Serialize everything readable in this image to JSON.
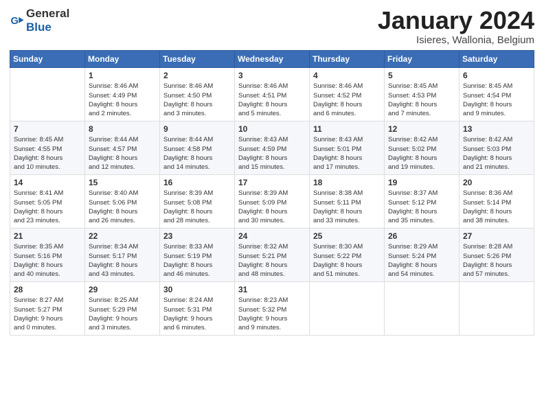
{
  "logo": {
    "text_general": "General",
    "text_blue": "Blue",
    "icon": "▶"
  },
  "header": {
    "month": "January 2024",
    "location": "Isieres, Wallonia, Belgium"
  },
  "weekdays": [
    "Sunday",
    "Monday",
    "Tuesday",
    "Wednesday",
    "Thursday",
    "Friday",
    "Saturday"
  ],
  "weeks": [
    [
      {
        "day": "",
        "info": ""
      },
      {
        "day": "1",
        "info": "Sunrise: 8:46 AM\nSunset: 4:49 PM\nDaylight: 8 hours\nand 2 minutes."
      },
      {
        "day": "2",
        "info": "Sunrise: 8:46 AM\nSunset: 4:50 PM\nDaylight: 8 hours\nand 3 minutes."
      },
      {
        "day": "3",
        "info": "Sunrise: 8:46 AM\nSunset: 4:51 PM\nDaylight: 8 hours\nand 5 minutes."
      },
      {
        "day": "4",
        "info": "Sunrise: 8:46 AM\nSunset: 4:52 PM\nDaylight: 8 hours\nand 6 minutes."
      },
      {
        "day": "5",
        "info": "Sunrise: 8:45 AM\nSunset: 4:53 PM\nDaylight: 8 hours\nand 7 minutes."
      },
      {
        "day": "6",
        "info": "Sunrise: 8:45 AM\nSunset: 4:54 PM\nDaylight: 8 hours\nand 9 minutes."
      }
    ],
    [
      {
        "day": "7",
        "info": "Sunrise: 8:45 AM\nSunset: 4:55 PM\nDaylight: 8 hours\nand 10 minutes."
      },
      {
        "day": "8",
        "info": "Sunrise: 8:44 AM\nSunset: 4:57 PM\nDaylight: 8 hours\nand 12 minutes."
      },
      {
        "day": "9",
        "info": "Sunrise: 8:44 AM\nSunset: 4:58 PM\nDaylight: 8 hours\nand 14 minutes."
      },
      {
        "day": "10",
        "info": "Sunrise: 8:43 AM\nSunset: 4:59 PM\nDaylight: 8 hours\nand 15 minutes."
      },
      {
        "day": "11",
        "info": "Sunrise: 8:43 AM\nSunset: 5:01 PM\nDaylight: 8 hours\nand 17 minutes."
      },
      {
        "day": "12",
        "info": "Sunrise: 8:42 AM\nSunset: 5:02 PM\nDaylight: 8 hours\nand 19 minutes."
      },
      {
        "day": "13",
        "info": "Sunrise: 8:42 AM\nSunset: 5:03 PM\nDaylight: 8 hours\nand 21 minutes."
      }
    ],
    [
      {
        "day": "14",
        "info": "Sunrise: 8:41 AM\nSunset: 5:05 PM\nDaylight: 8 hours\nand 23 minutes."
      },
      {
        "day": "15",
        "info": "Sunrise: 8:40 AM\nSunset: 5:06 PM\nDaylight: 8 hours\nand 26 minutes."
      },
      {
        "day": "16",
        "info": "Sunrise: 8:39 AM\nSunset: 5:08 PM\nDaylight: 8 hours\nand 28 minutes."
      },
      {
        "day": "17",
        "info": "Sunrise: 8:39 AM\nSunset: 5:09 PM\nDaylight: 8 hours\nand 30 minutes."
      },
      {
        "day": "18",
        "info": "Sunrise: 8:38 AM\nSunset: 5:11 PM\nDaylight: 8 hours\nand 33 minutes."
      },
      {
        "day": "19",
        "info": "Sunrise: 8:37 AM\nSunset: 5:12 PM\nDaylight: 8 hours\nand 35 minutes."
      },
      {
        "day": "20",
        "info": "Sunrise: 8:36 AM\nSunset: 5:14 PM\nDaylight: 8 hours\nand 38 minutes."
      }
    ],
    [
      {
        "day": "21",
        "info": "Sunrise: 8:35 AM\nSunset: 5:16 PM\nDaylight: 8 hours\nand 40 minutes."
      },
      {
        "day": "22",
        "info": "Sunrise: 8:34 AM\nSunset: 5:17 PM\nDaylight: 8 hours\nand 43 minutes."
      },
      {
        "day": "23",
        "info": "Sunrise: 8:33 AM\nSunset: 5:19 PM\nDaylight: 8 hours\nand 46 minutes."
      },
      {
        "day": "24",
        "info": "Sunrise: 8:32 AM\nSunset: 5:21 PM\nDaylight: 8 hours\nand 48 minutes."
      },
      {
        "day": "25",
        "info": "Sunrise: 8:30 AM\nSunset: 5:22 PM\nDaylight: 8 hours\nand 51 minutes."
      },
      {
        "day": "26",
        "info": "Sunrise: 8:29 AM\nSunset: 5:24 PM\nDaylight: 8 hours\nand 54 minutes."
      },
      {
        "day": "27",
        "info": "Sunrise: 8:28 AM\nSunset: 5:26 PM\nDaylight: 8 hours\nand 57 minutes."
      }
    ],
    [
      {
        "day": "28",
        "info": "Sunrise: 8:27 AM\nSunset: 5:27 PM\nDaylight: 9 hours\nand 0 minutes."
      },
      {
        "day": "29",
        "info": "Sunrise: 8:25 AM\nSunset: 5:29 PM\nDaylight: 9 hours\nand 3 minutes."
      },
      {
        "day": "30",
        "info": "Sunrise: 8:24 AM\nSunset: 5:31 PM\nDaylight: 9 hours\nand 6 minutes."
      },
      {
        "day": "31",
        "info": "Sunrise: 8:23 AM\nSunset: 5:32 PM\nDaylight: 9 hours\nand 9 minutes."
      },
      {
        "day": "",
        "info": ""
      },
      {
        "day": "",
        "info": ""
      },
      {
        "day": "",
        "info": ""
      }
    ]
  ]
}
